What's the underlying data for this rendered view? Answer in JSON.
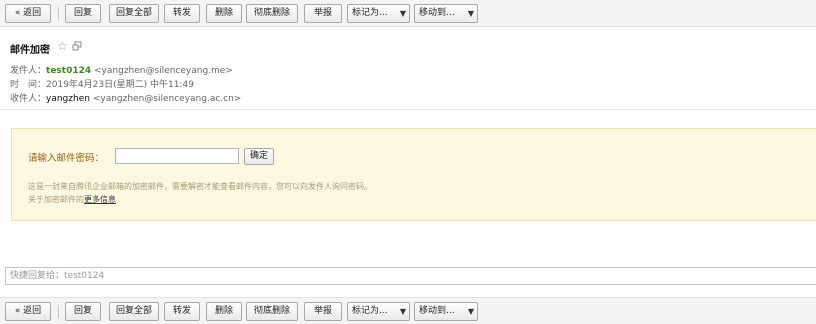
{
  "toolbar": {
    "back": "« 返回",
    "reply": "回复",
    "reply_all": "回复全部",
    "forward": "转发",
    "delete": "删除",
    "delete_permanently": "彻底删除",
    "report": "举报",
    "mark_as": "标记为...",
    "move_to": "移动到..."
  },
  "mail": {
    "subject": "邮件加密",
    "from_label": "发件人：",
    "from_name": "test0124",
    "from_addr": "<yangzhen@silenceyang.me>",
    "time_label": "时　间：",
    "time_value": "2019年4月23日(星期二) 中午11:49",
    "to_label": "收件人：",
    "to_name": "yangzhen",
    "to_addr": "<yangzhen@silenceyang.ac.cn>"
  },
  "encryption": {
    "password_label": "请输入邮件密码：",
    "password_value": "",
    "confirm_label": "确定",
    "hint": "这是一封来自腾讯企业邮箱的加密邮件，需要解密才能查看邮件内容，您可以向发件人询问密码。",
    "more_prefix": "关于加密邮件的",
    "more_link": "更多信息"
  },
  "quick_reply": {
    "placeholder": "快捷回复给：test0124"
  },
  "icons": {
    "star": "star-outline",
    "popout": "open-in-new-window"
  },
  "colors": {
    "sender": "#3a8a1f",
    "panel_bg": "#fdf8e2",
    "panel_label": "#9a5b0f"
  }
}
